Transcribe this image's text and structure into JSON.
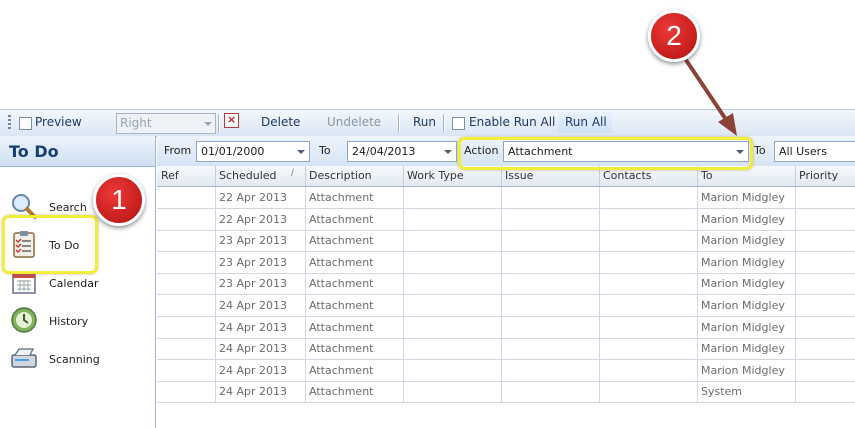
{
  "toolbar": {
    "preview_label": "Preview",
    "position_select_value": "Right",
    "delete_label": "Delete",
    "undelete_label": "Undelete",
    "run_label": "Run",
    "enable_run_all_label": "Enable Run All",
    "run_all_label": "Run All"
  },
  "sidebar": {
    "title": "To Do",
    "items": [
      {
        "label": "Search",
        "icon": "search-icon"
      },
      {
        "label": "To Do",
        "icon": "clipboard-icon"
      },
      {
        "label": "Calendar",
        "icon": "calendar-icon"
      },
      {
        "label": "History",
        "icon": "history-icon"
      },
      {
        "label": "Scanning",
        "icon": "scanner-icon"
      }
    ]
  },
  "filters": {
    "from_label": "From",
    "from_value": "01/01/2000",
    "to_label": "To",
    "to_value": "24/04/2013",
    "action_label": "Action",
    "action_value": "Attachment",
    "to_user_label": "To",
    "to_user_value": "All Users"
  },
  "grid": {
    "columns": [
      "Ref",
      "Scheduled",
      "Description",
      "Work Type",
      "Issue",
      "Contacts",
      "To",
      "Priority"
    ],
    "rows": [
      [
        "",
        "22 Apr 2013",
        "Attachment",
        "",
        "",
        "",
        "Marion Midgley",
        ""
      ],
      [
        "",
        "22 Apr 2013",
        "Attachment",
        "",
        "",
        "",
        "Marion Midgley",
        ""
      ],
      [
        "",
        "23 Apr 2013",
        "Attachment",
        "",
        "",
        "",
        "Marion Midgley",
        ""
      ],
      [
        "",
        "23 Apr 2013",
        "Attachment",
        "",
        "",
        "",
        "Marion Midgley",
        ""
      ],
      [
        "",
        "23 Apr 2013",
        "Attachment",
        "",
        "",
        "",
        "Marion Midgley",
        ""
      ],
      [
        "",
        "24 Apr 2013",
        "Attachment",
        "",
        "",
        "",
        "Marion Midgley",
        ""
      ],
      [
        "",
        "24 Apr 2013",
        "Attachment",
        "",
        "",
        "",
        "Marion Midgley",
        ""
      ],
      [
        "",
        "24 Apr 2013",
        "Attachment",
        "",
        "",
        "",
        "Marion Midgley",
        ""
      ],
      [
        "",
        "24 Apr 2013",
        "Attachment",
        "",
        "",
        "",
        "Marion Midgley",
        ""
      ],
      [
        "",
        "24 Apr 2013",
        "Attachment",
        "",
        "",
        "",
        "System",
        ""
      ]
    ]
  },
  "annotations": {
    "step1": "1",
    "step2": "2"
  },
  "colors": {
    "callout_red": "#c8141a",
    "highlight_yellow": "#f2ec3a",
    "header_blue": "#163e73"
  }
}
